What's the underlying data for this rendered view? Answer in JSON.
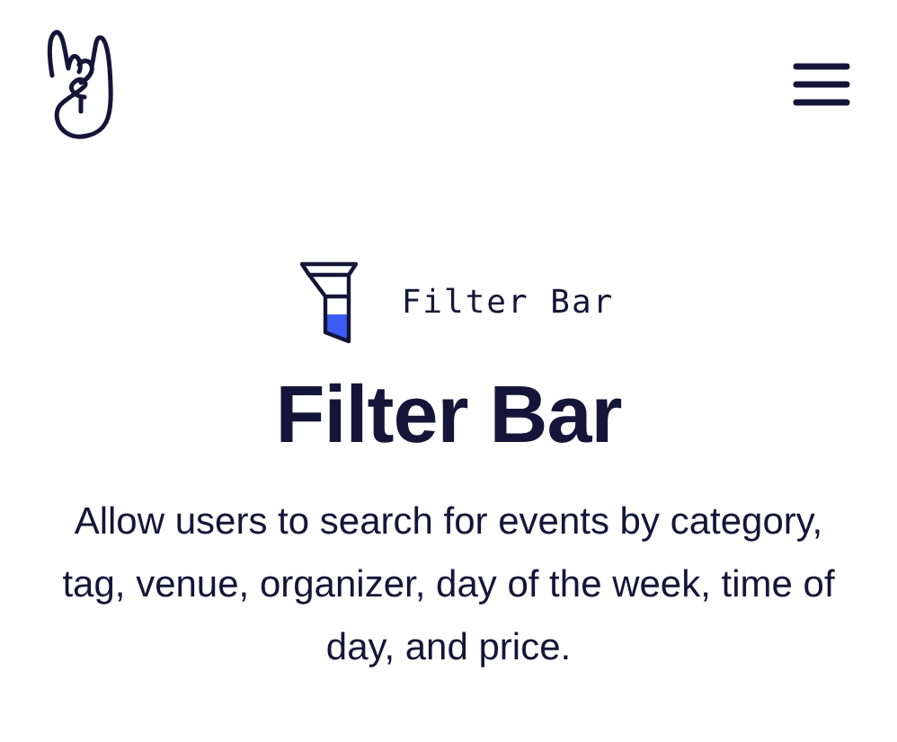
{
  "eyebrow": "Filter Bar",
  "heading": "Filter Bar",
  "description": "Allow users to search for events by category, tag, venue, organizer, day of the week, time of day, and price."
}
